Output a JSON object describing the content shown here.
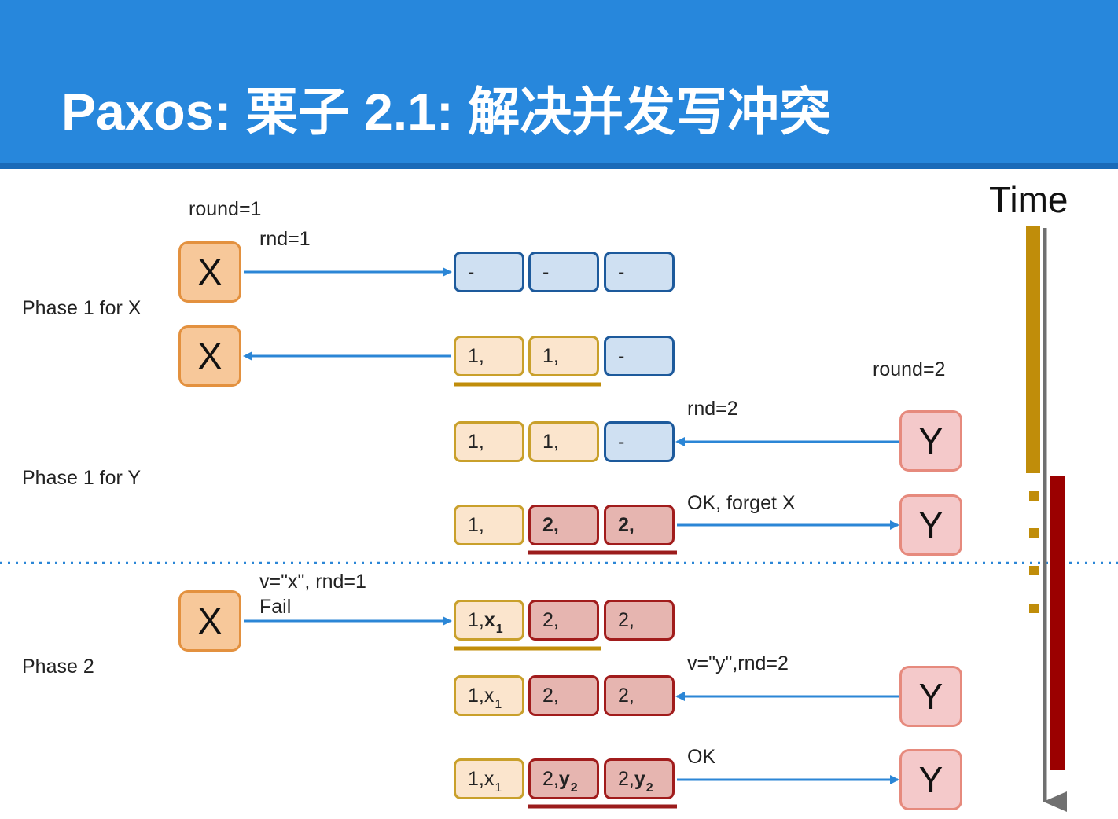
{
  "title": "Paxos: 栗子 2.1: 解决并发写冲突",
  "time_label": "Time",
  "phases": {
    "phase1_x": "Phase 1 for X",
    "phase1_y": "Phase 1 for Y",
    "phase2": "Phase 2"
  },
  "annotations": {
    "round_x": "round=1",
    "rnd_x": "rnd=1",
    "round_y": "round=2",
    "rnd_y": "rnd=2",
    "ok_forget": "OK, forget X",
    "vx_rnd": "v=\"x\", rnd=1",
    "fail": "Fail",
    "vy_rnd": "v=\"y\",rnd=2",
    "ok": "OK"
  },
  "nodes": {
    "x": "X",
    "y": "Y"
  },
  "acceptor_rows": [
    {
      "cells": [
        {
          "text": "-",
          "state": "blue"
        },
        {
          "text": "-",
          "state": "blue"
        },
        {
          "text": "-",
          "state": "blue"
        }
      ]
    },
    {
      "cells": [
        {
          "text": "1,",
          "state": "tan"
        },
        {
          "text": "1,",
          "state": "tan"
        },
        {
          "text": "-",
          "state": "blue"
        }
      ]
    },
    {
      "cells": [
        {
          "text": "1,",
          "state": "tan"
        },
        {
          "text": "1,",
          "state": "tan"
        },
        {
          "text": "-",
          "state": "blue"
        }
      ]
    },
    {
      "cells": [
        {
          "text": "1,",
          "state": "tan"
        },
        {
          "text": "2,",
          "state": "red",
          "bold": true
        },
        {
          "text": "2,",
          "state": "red",
          "bold": true
        }
      ]
    },
    {
      "cells": [
        {
          "text": "1,",
          "state": "tan",
          "value": "x",
          "sub": "1",
          "bold_value": true
        },
        {
          "text": "2,",
          "state": "red"
        },
        {
          "text": "2,",
          "state": "red"
        }
      ]
    },
    {
      "cells": [
        {
          "text": "1,",
          "state": "tan",
          "value": "x",
          "sub": "1"
        },
        {
          "text": "2,",
          "state": "red"
        },
        {
          "text": "2,",
          "state": "red"
        }
      ]
    },
    {
      "cells": [
        {
          "text": "1,",
          "state": "tan",
          "value": "x",
          "sub": "1"
        },
        {
          "text": "2,",
          "state": "red",
          "value": "y",
          "sub": "2",
          "bold_value": true
        },
        {
          "text": "2,",
          "state": "red",
          "value": "y",
          "sub": "2",
          "bold_value": true
        }
      ]
    }
  ],
  "colors": {
    "header": "#2787dc",
    "arrow": "#2b86d6",
    "round1": "#c08d0a",
    "round2": "#9b0000",
    "timeline": "#707070"
  }
}
